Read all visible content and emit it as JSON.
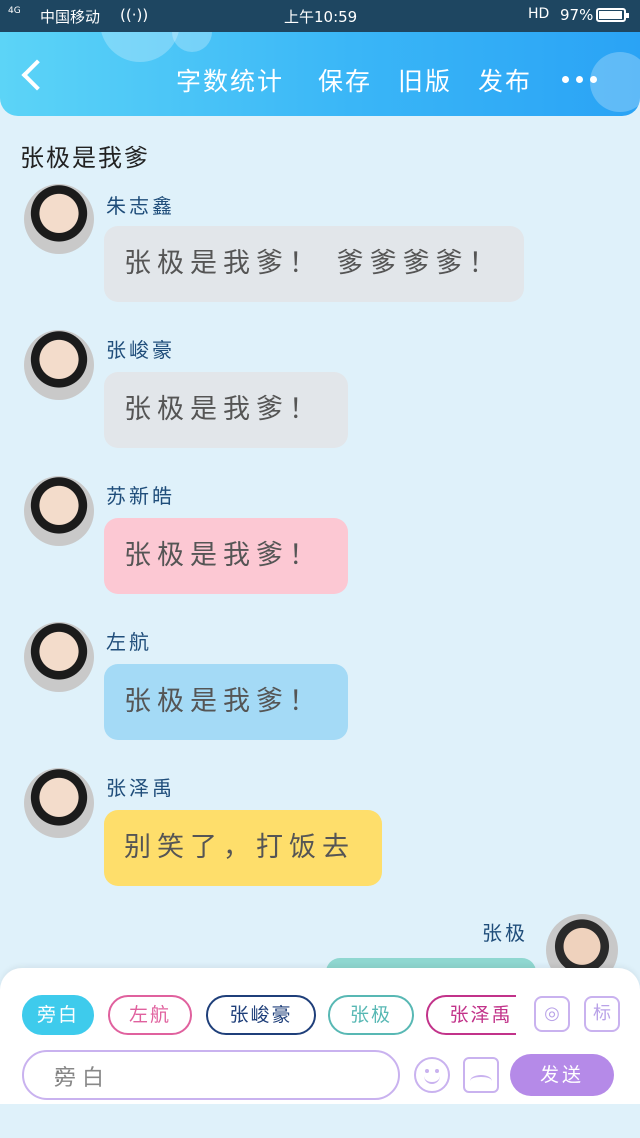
{
  "status_bar": {
    "signal": "4G",
    "carrier": "中国移动",
    "time": "上午10:59",
    "hd": "HD",
    "battery_text": "97%",
    "battery_level": 0.97
  },
  "top_bar": {
    "menu": [
      "字数统计",
      "保存",
      "旧版",
      "发布"
    ]
  },
  "chat_title": "张极是我爹",
  "messages": [
    {
      "name": "朱志鑫",
      "text": "张极是我爹！ 爹爹爹爹！",
      "bubble_color": "#e2e6ea"
    },
    {
      "name": "张峻豪",
      "text": "张极是我爹！",
      "bubble_color": "#e2e6ea"
    },
    {
      "name": "苏新皓",
      "text": "张极是我爹！",
      "bubble_color": "#fcc8d3"
    },
    {
      "name": "左航",
      "text": "张极是我爹！",
      "bubble_color": "#a4daf6"
    },
    {
      "name": "张泽禹",
      "text": "别笑了，打饭去",
      "bubble_color": "#fede6b"
    }
  ],
  "self_message": {
    "name": "张极",
    "bubble_color": "#8fd7d0"
  },
  "roles": [
    {
      "label": "旁白",
      "border": "#3ecbec",
      "text_color": "#ffffff",
      "fill": "#3ecbec"
    },
    {
      "label": "左航",
      "border": "#e0619e",
      "text_color": "#e0619e",
      "fill": "#ffffff"
    },
    {
      "label": "张峻豪",
      "border": "#1f3f7a",
      "text_color": "#1f3f7a",
      "fill": "#ffffff"
    },
    {
      "label": "张极",
      "border": "#58b8b4",
      "text_color": "#58b8b4",
      "fill": "#ffffff"
    },
    {
      "label": "张泽禹",
      "border": "#c2338a",
      "text_color": "#c2338a",
      "fill": "#ffffff"
    }
  ],
  "tools": {
    "tag_label": "标"
  },
  "input": {
    "prefix": "旁白",
    "placeholder": ":"
  },
  "send_label": "发送"
}
